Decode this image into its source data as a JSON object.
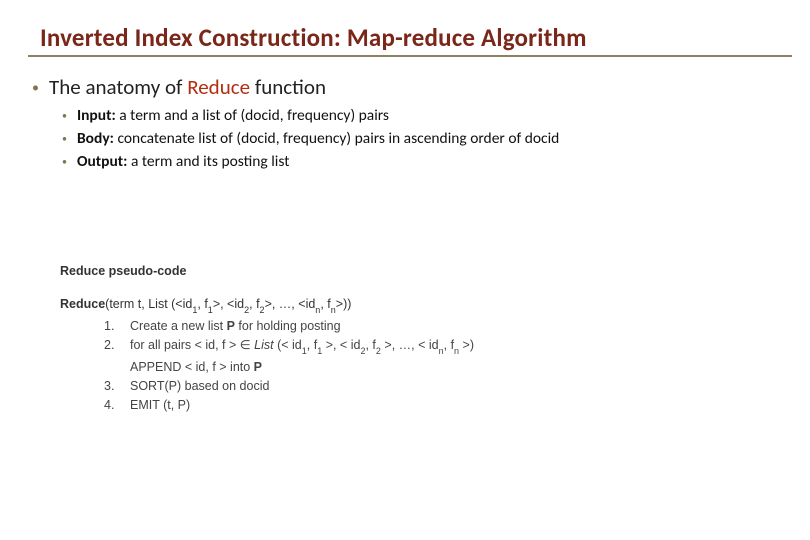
{
  "title": "Inverted Index Construction: Map-reduce Algorithm",
  "main": {
    "prefix": "The anatomy of ",
    "accent": "Reduce",
    "suffix": " function"
  },
  "sub": {
    "input_label": "Input:",
    "input_text": "  a term and a list of (docid, frequency) pairs",
    "body_label": "Body:",
    "body_text": "   concatenate list of (docid, frequency) pairs in ascending order of docid",
    "output_label": "Output:",
    "output_text": " a term and its posting list"
  },
  "pseudo": {
    "heading": "Reduce pseudo-code",
    "sig_name": "Reduce",
    "sig_param_prefix": "(term t,  List (<",
    "id_lbl": "id",
    "f_lbl": "f",
    "sig_sep": ">, <",
    "sig_ell": ">, …, <",
    "sig_end": ">))",
    "step1": "Create a new list ",
    "step1_bold": "P",
    "step1_rest": " for holding posting",
    "step2_a": "for all pairs < id,  f > ∈ ",
    "step2_list": "List",
    "step2_b": " (< ",
    "step2_c": " >, < ",
    "step2_d": " >, …, < ",
    "step2_e": " >)",
    "append": "APPEND < id,  f > into ",
    "append_bold": "P",
    "step3": "SORT(P) based on docid",
    "step4": "EMIT (t, P)",
    "sub_1": "1",
    "sub_2": "2",
    "sub_n": "n"
  }
}
